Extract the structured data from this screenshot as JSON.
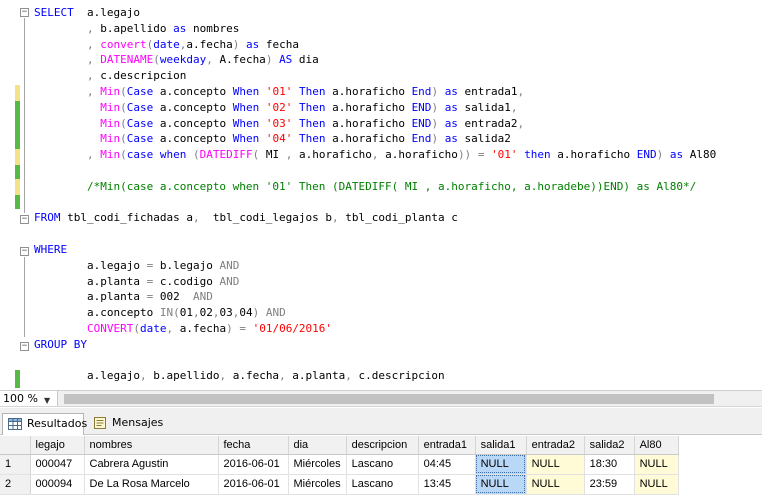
{
  "editor": {
    "lines": [
      [
        [
          "k",
          "SELECT"
        ],
        [
          "n",
          "  a.legajo"
        ]
      ],
      [
        [
          "n",
          "        "
        ],
        [
          "g",
          ","
        ],
        [
          "n",
          " b.apellido "
        ],
        [
          "k",
          "as"
        ],
        [
          "n",
          " nombres"
        ]
      ],
      [
        [
          "n",
          "        "
        ],
        [
          "g",
          ","
        ],
        [
          "n",
          " "
        ],
        [
          "f",
          "convert"
        ],
        [
          "g",
          "("
        ],
        [
          "k",
          "date"
        ],
        [
          "g",
          ","
        ],
        [
          "n",
          "a.fecha"
        ],
        [
          "g",
          ")"
        ],
        [
          "n",
          " "
        ],
        [
          "k",
          "as"
        ],
        [
          "n",
          " fecha"
        ]
      ],
      [
        [
          "n",
          "        "
        ],
        [
          "g",
          ","
        ],
        [
          "n",
          " "
        ],
        [
          "f",
          "DATENAME"
        ],
        [
          "g",
          "("
        ],
        [
          "k",
          "weekday"
        ],
        [
          "g",
          ","
        ],
        [
          "n",
          " A.fecha"
        ],
        [
          "g",
          ")"
        ],
        [
          "n",
          " "
        ],
        [
          "k",
          "AS"
        ],
        [
          "n",
          " dia"
        ]
      ],
      [
        [
          "n",
          "        "
        ],
        [
          "g",
          ","
        ],
        [
          "n",
          " c.descripcion"
        ]
      ],
      [
        [
          "n",
          "        "
        ],
        [
          "g",
          ","
        ],
        [
          "n",
          " "
        ],
        [
          "f",
          "Min"
        ],
        [
          "g",
          "("
        ],
        [
          "k",
          "Case"
        ],
        [
          "n",
          " a.concepto "
        ],
        [
          "k",
          "When"
        ],
        [
          "n",
          " "
        ],
        [
          "s",
          "'01'"
        ],
        [
          "n",
          " "
        ],
        [
          "k",
          "Then"
        ],
        [
          "n",
          " a.horaficho "
        ],
        [
          "k",
          "End"
        ],
        [
          "g",
          ")"
        ],
        [
          "n",
          " "
        ],
        [
          "k",
          "as"
        ],
        [
          "n",
          " entrada1"
        ],
        [
          "g",
          ","
        ]
      ],
      [
        [
          "n",
          "          "
        ],
        [
          "f",
          "Min"
        ],
        [
          "g",
          "("
        ],
        [
          "k",
          "Case"
        ],
        [
          "n",
          " a.concepto "
        ],
        [
          "k",
          "When"
        ],
        [
          "n",
          " "
        ],
        [
          "s",
          "'02'"
        ],
        [
          "n",
          " "
        ],
        [
          "k",
          "Then"
        ],
        [
          "n",
          " a.horaficho "
        ],
        [
          "k",
          "END"
        ],
        [
          "g",
          ")"
        ],
        [
          "n",
          " "
        ],
        [
          "k",
          "as"
        ],
        [
          "n",
          " salida1"
        ],
        [
          "g",
          ","
        ]
      ],
      [
        [
          "n",
          "          "
        ],
        [
          "f",
          "Min"
        ],
        [
          "g",
          "("
        ],
        [
          "k",
          "Case"
        ],
        [
          "n",
          " a.concepto "
        ],
        [
          "k",
          "When"
        ],
        [
          "n",
          " "
        ],
        [
          "s",
          "'03'"
        ],
        [
          "n",
          " "
        ],
        [
          "k",
          "Then"
        ],
        [
          "n",
          " a.horaficho "
        ],
        [
          "k",
          "END"
        ],
        [
          "g",
          ")"
        ],
        [
          "n",
          " "
        ],
        [
          "k",
          "as"
        ],
        [
          "n",
          " entrada2"
        ],
        [
          "g",
          ","
        ]
      ],
      [
        [
          "n",
          "          "
        ],
        [
          "f",
          "Min"
        ],
        [
          "g",
          "("
        ],
        [
          "k",
          "Case"
        ],
        [
          "n",
          " a.concepto "
        ],
        [
          "k",
          "When"
        ],
        [
          "n",
          " "
        ],
        [
          "s",
          "'04'"
        ],
        [
          "n",
          " "
        ],
        [
          "k",
          "Then"
        ],
        [
          "n",
          " a.horaficho "
        ],
        [
          "k",
          "End"
        ],
        [
          "g",
          ")"
        ],
        [
          "n",
          " "
        ],
        [
          "k",
          "as"
        ],
        [
          "n",
          " salida2"
        ]
      ],
      [
        [
          "n",
          "        "
        ],
        [
          "g",
          ","
        ],
        [
          "n",
          " "
        ],
        [
          "f",
          "Min"
        ],
        [
          "g",
          "("
        ],
        [
          "k",
          "case"
        ],
        [
          "n",
          " "
        ],
        [
          "k",
          "when"
        ],
        [
          "n",
          " "
        ],
        [
          "g",
          "("
        ],
        [
          "f",
          "DATEDIFF"
        ],
        [
          "g",
          "("
        ],
        [
          "n",
          " MI "
        ],
        [
          "g",
          ","
        ],
        [
          "n",
          " a.horaficho"
        ],
        [
          "g",
          ","
        ],
        [
          "n",
          " a.horaficho"
        ],
        [
          "g",
          "))"
        ],
        [
          "n",
          " "
        ],
        [
          "g",
          "="
        ],
        [
          "n",
          " "
        ],
        [
          "s",
          "'01'"
        ],
        [
          "n",
          " "
        ],
        [
          "k",
          "then"
        ],
        [
          "n",
          " a.horaficho "
        ],
        [
          "k",
          "END"
        ],
        [
          "g",
          ")"
        ],
        [
          "n",
          " "
        ],
        [
          "k",
          "as"
        ],
        [
          "n",
          " Al80"
        ]
      ],
      [],
      [
        [
          "n",
          "        "
        ],
        [
          "c",
          "/*Min(case a.concepto when '01' Then (DATEDIFF( MI , a.horaficho, a.horadebe))END) as Al80*/"
        ]
      ],
      [],
      [
        [
          "k",
          "FROM"
        ],
        [
          "n",
          " tbl_codi_fichadas a"
        ],
        [
          "g",
          ","
        ],
        [
          "n",
          "  tbl_codi_legajos b"
        ],
        [
          "g",
          ","
        ],
        [
          "n",
          " tbl_codi_planta c"
        ]
      ],
      [],
      [
        [
          "k",
          "WHERE"
        ]
      ],
      [
        [
          "n",
          "        a.legajo "
        ],
        [
          "g",
          "="
        ],
        [
          "n",
          " b.legajo "
        ],
        [
          "g",
          "AND"
        ]
      ],
      [
        [
          "n",
          "        a.planta "
        ],
        [
          "g",
          "="
        ],
        [
          "n",
          " c.codigo "
        ],
        [
          "g",
          "AND"
        ]
      ],
      [
        [
          "n",
          "        a.planta "
        ],
        [
          "g",
          "="
        ],
        [
          "n",
          " 002  "
        ],
        [
          "g",
          "AND"
        ]
      ],
      [
        [
          "n",
          "        a.concepto "
        ],
        [
          "g",
          "IN("
        ],
        [
          "n",
          "01"
        ],
        [
          "g",
          ","
        ],
        [
          "n",
          "02"
        ],
        [
          "g",
          ","
        ],
        [
          "n",
          "03"
        ],
        [
          "g",
          ","
        ],
        [
          "n",
          "04"
        ],
        [
          "g",
          ")"
        ],
        [
          "n",
          " "
        ],
        [
          "g",
          "AND"
        ]
      ],
      [
        [
          "n",
          "        "
        ],
        [
          "f",
          "CONVERT"
        ],
        [
          "g",
          "("
        ],
        [
          "k",
          "date"
        ],
        [
          "g",
          ","
        ],
        [
          "n",
          " a.fecha"
        ],
        [
          "g",
          ")"
        ],
        [
          "n",
          " "
        ],
        [
          "g",
          "="
        ],
        [
          "n",
          " "
        ],
        [
          "s",
          "'01/06/2016'"
        ]
      ],
      [
        [
          "k",
          "GROUP BY"
        ]
      ],
      [],
      [
        [
          "n",
          "        a.legajo"
        ],
        [
          "g",
          ","
        ],
        [
          "n",
          " b.apellido"
        ],
        [
          "g",
          ","
        ],
        [
          "n",
          " a.fecha"
        ],
        [
          "g",
          ","
        ],
        [
          "n",
          " a.planta"
        ],
        [
          "g",
          ","
        ],
        [
          "n",
          " c.descripcion"
        ]
      ]
    ]
  },
  "zoom": {
    "label": "100 %"
  },
  "tabs": [
    {
      "label": "Resultados",
      "icon": "grid-results-icon"
    },
    {
      "label": "Mensajes",
      "icon": "messages-icon"
    }
  ],
  "grid": {
    "columns": [
      "legajo",
      "nombres",
      "fecha",
      "dia",
      "descripcion",
      "entrada1",
      "salida1",
      "entrada2",
      "salida2",
      "Al80"
    ],
    "rows": [
      {
        "num": "1",
        "cells": [
          "000047",
          "Cabrera Agustin",
          "2016-06-01",
          "Miércoles",
          "Lascano",
          "04:45",
          "NULL",
          "NULL",
          "18:30",
          "NULL"
        ]
      },
      {
        "num": "2",
        "cells": [
          "000094",
          "De La Rosa Marcelo",
          "2016-06-01",
          "Miércoles",
          "Lascano",
          "13:45",
          "NULL",
          "NULL",
          "23:59",
          "NULL"
        ]
      }
    ]
  },
  "colors": {
    "keyword": "#0000ff",
    "function": "#ff00ff",
    "string": "#ff0000",
    "operator": "#808080",
    "comment": "#008000"
  }
}
